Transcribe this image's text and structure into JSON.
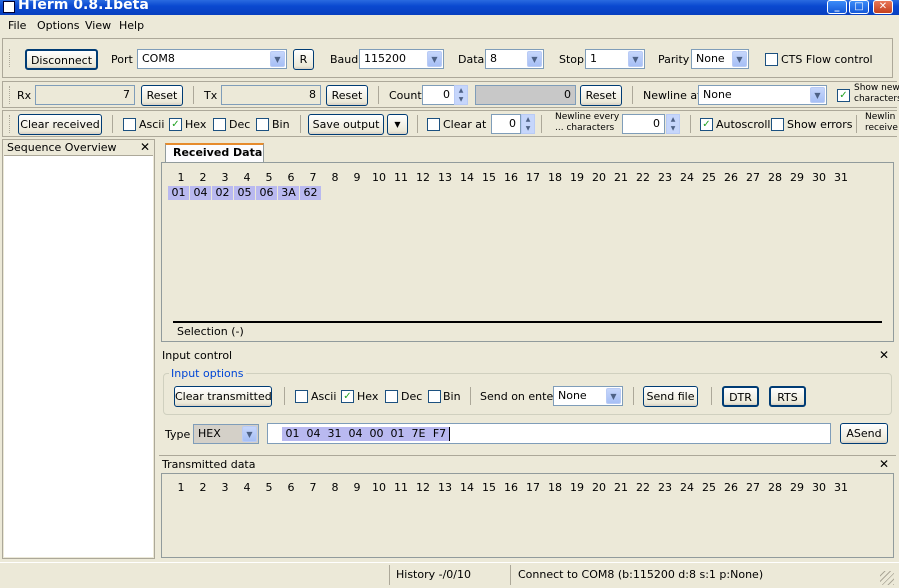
{
  "window": {
    "title": "HTerm 0.8.1beta",
    "minimize": "_",
    "maximize": "□",
    "close": "✕"
  },
  "menu": [
    "File",
    "Options",
    "View",
    "Help"
  ],
  "connection": {
    "disconnect_label": "Disconnect",
    "port_label": "Port",
    "port_value": "COM8",
    "refresh_label": "R",
    "baud_label": "Baud",
    "baud_value": "115200",
    "data_label": "Data",
    "data_value": "8",
    "stop_label": "Stop",
    "stop_value": "1",
    "parity_label": "Parity",
    "parity_value": "None",
    "cts_label": "CTS Flow control",
    "cts_checked": false
  },
  "counters": {
    "rx_label": "Rx",
    "rx_value": "7",
    "rx_reset": "Reset",
    "tx_label": "Tx",
    "tx_value": "8",
    "tx_reset": "Reset",
    "count_label": "Count",
    "count_value": "0",
    "count_display": "0",
    "count_reset": "Reset",
    "newline_at_label": "Newline at",
    "newline_at_value": "None",
    "show_newline_label_1": "Show new",
    "show_newline_label_2": "characters",
    "show_newline_checked": true
  },
  "receive_options": {
    "clear_received": "Clear received",
    "ascii": "Ascii",
    "ascii_checked": false,
    "hex": "Hex",
    "hex_checked": true,
    "dec": "Dec",
    "dec_checked": false,
    "bin": "Bin",
    "bin_checked": false,
    "save_output": "Save output",
    "clear_at_label": "Clear at",
    "clear_at_value": "0",
    "newline_every_1": "Newline every",
    "newline_every_2": "... characters",
    "newline_every_value": "0",
    "autoscroll": "Autoscroll",
    "autoscroll_checked": true,
    "show_errors": "Show errors",
    "show_errors_checked": false,
    "newline_receive_1": "Newlin",
    "newline_receive_2": "receive"
  },
  "sequence_overview": {
    "title": "Sequence Overview",
    "close": "✕"
  },
  "received": {
    "tab": "Received Data",
    "columns": [
      "1",
      "2",
      "3",
      "4",
      "5",
      "6",
      "7",
      "8",
      "9",
      "10",
      "11",
      "12",
      "13",
      "14",
      "15",
      "16",
      "17",
      "18",
      "19",
      "20",
      "21",
      "22",
      "23",
      "24",
      "25",
      "26",
      "27",
      "28",
      "29",
      "30",
      "31"
    ],
    "bytes": [
      "01",
      "04",
      "02",
      "05",
      "06",
      "3A",
      "62"
    ],
    "selection": "Selection (-)"
  },
  "input_control": {
    "title": "Input control",
    "close": "✕",
    "options_title": "Input options",
    "clear_transmitted": "Clear transmitted",
    "ascii": "Ascii",
    "ascii_checked": false,
    "hex": "Hex",
    "hex_checked": true,
    "dec": "Dec",
    "dec_checked": false,
    "bin": "Bin",
    "bin_checked": false,
    "send_on_enter_label": "Send on enter",
    "send_on_enter_value": "None",
    "send_file": "Send file",
    "dtr": "DTR",
    "rts": "RTS",
    "type_label": "Type",
    "type_value": "HEX",
    "input_bytes": [
      "01",
      "04",
      "31",
      "04",
      "00",
      "01",
      "7E",
      "F7"
    ],
    "send_button": "ASend"
  },
  "transmitted": {
    "title": "Transmitted data",
    "close": "✕",
    "columns": [
      "1",
      "2",
      "3",
      "4",
      "5",
      "6",
      "7",
      "8",
      "9",
      "10",
      "11",
      "12",
      "13",
      "14",
      "15",
      "16",
      "17",
      "18",
      "19",
      "20",
      "21",
      "22",
      "23",
      "24",
      "25",
      "26",
      "27",
      "28",
      "29",
      "30",
      "31"
    ]
  },
  "status": {
    "history": "History -/0/10",
    "connection": "Connect to COM8 (b:115200 d:8 s:1 p:None)"
  }
}
